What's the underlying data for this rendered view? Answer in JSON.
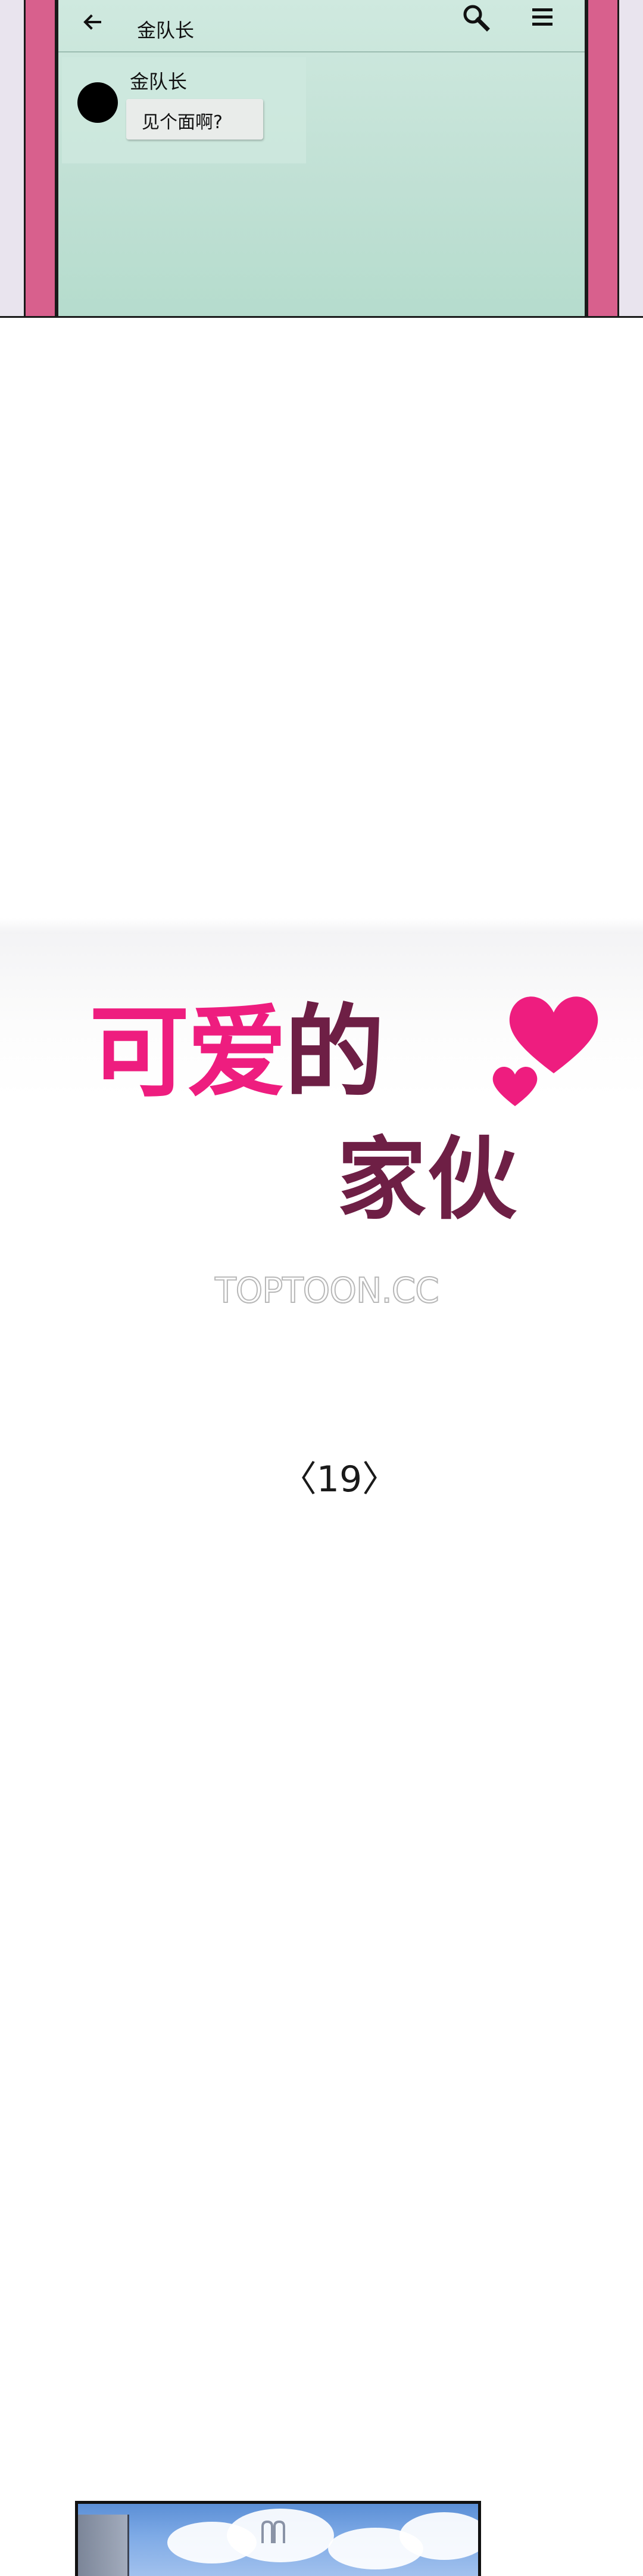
{
  "chat_panel": {
    "app_title": "金队长",
    "back_icon": "arrow-left-icon",
    "search_icon": "search-icon",
    "menu_icon": "menu-icon",
    "message": {
      "sender": "金队长",
      "text": "见个面啊?"
    }
  },
  "title_card": {
    "title_part1": "可爱",
    "title_part2": "的",
    "title_line2": "家伙",
    "decoration": "hearts-icon",
    "watermark": "TOPTOON.CC",
    "episode": "〈19〉"
  },
  "colors": {
    "title_pink": "#ee1d7f",
    "title_plum": "#6e1f45",
    "phone_screen": "#c6e4d8",
    "bezel": "#d8608d"
  }
}
